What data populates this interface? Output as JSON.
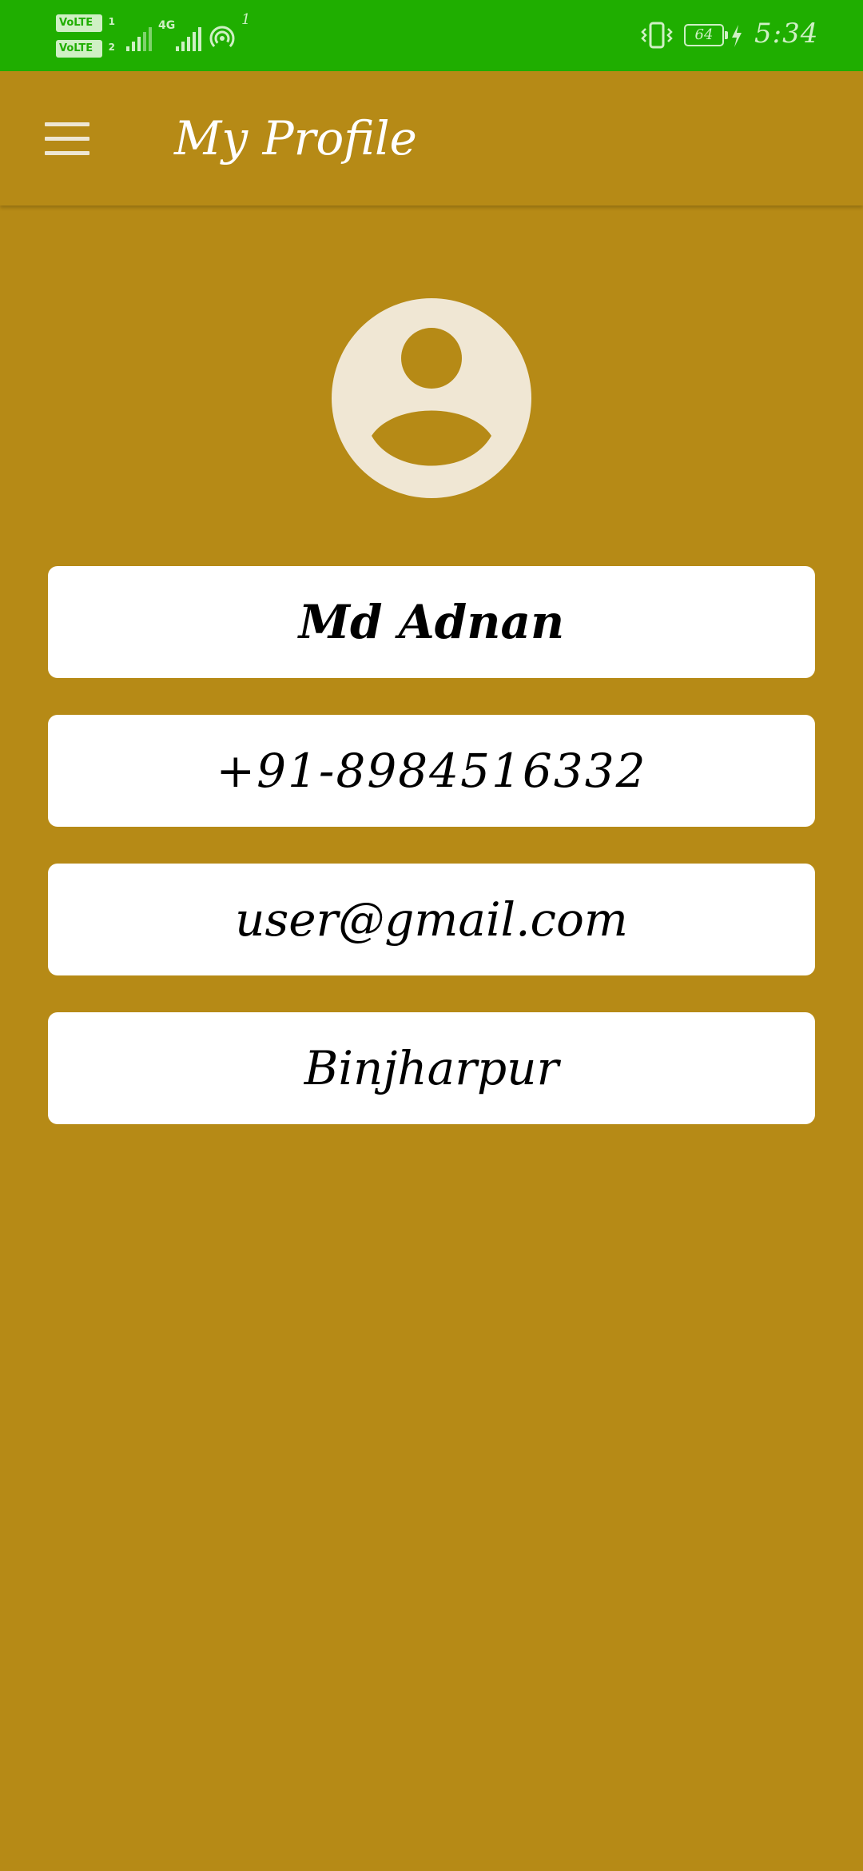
{
  "status_bar": {
    "sim1_label": "VoLTE",
    "sim1_number": "1",
    "sim2_label": "VoLTE",
    "sim2_number": "2",
    "network_type": "4G",
    "hotspot_count": "1",
    "battery_level": "64",
    "time": "5:34",
    "background_color": "#1FAE00"
  },
  "app_bar": {
    "title": "My Profile",
    "menu_icon": "hamburger-menu-icon",
    "background_color": "#B68A16"
  },
  "profile": {
    "avatar_icon": "user-avatar-icon",
    "name": "Md Adnan",
    "phone": "+91-8984516332",
    "email": "user@gmail.com",
    "city": "Binjharpur"
  },
  "colors": {
    "accent": "#B68A16",
    "card": "#FFFFFF",
    "avatar_bg": "#F0E7D4",
    "avatar_fg": "#B68A16"
  }
}
